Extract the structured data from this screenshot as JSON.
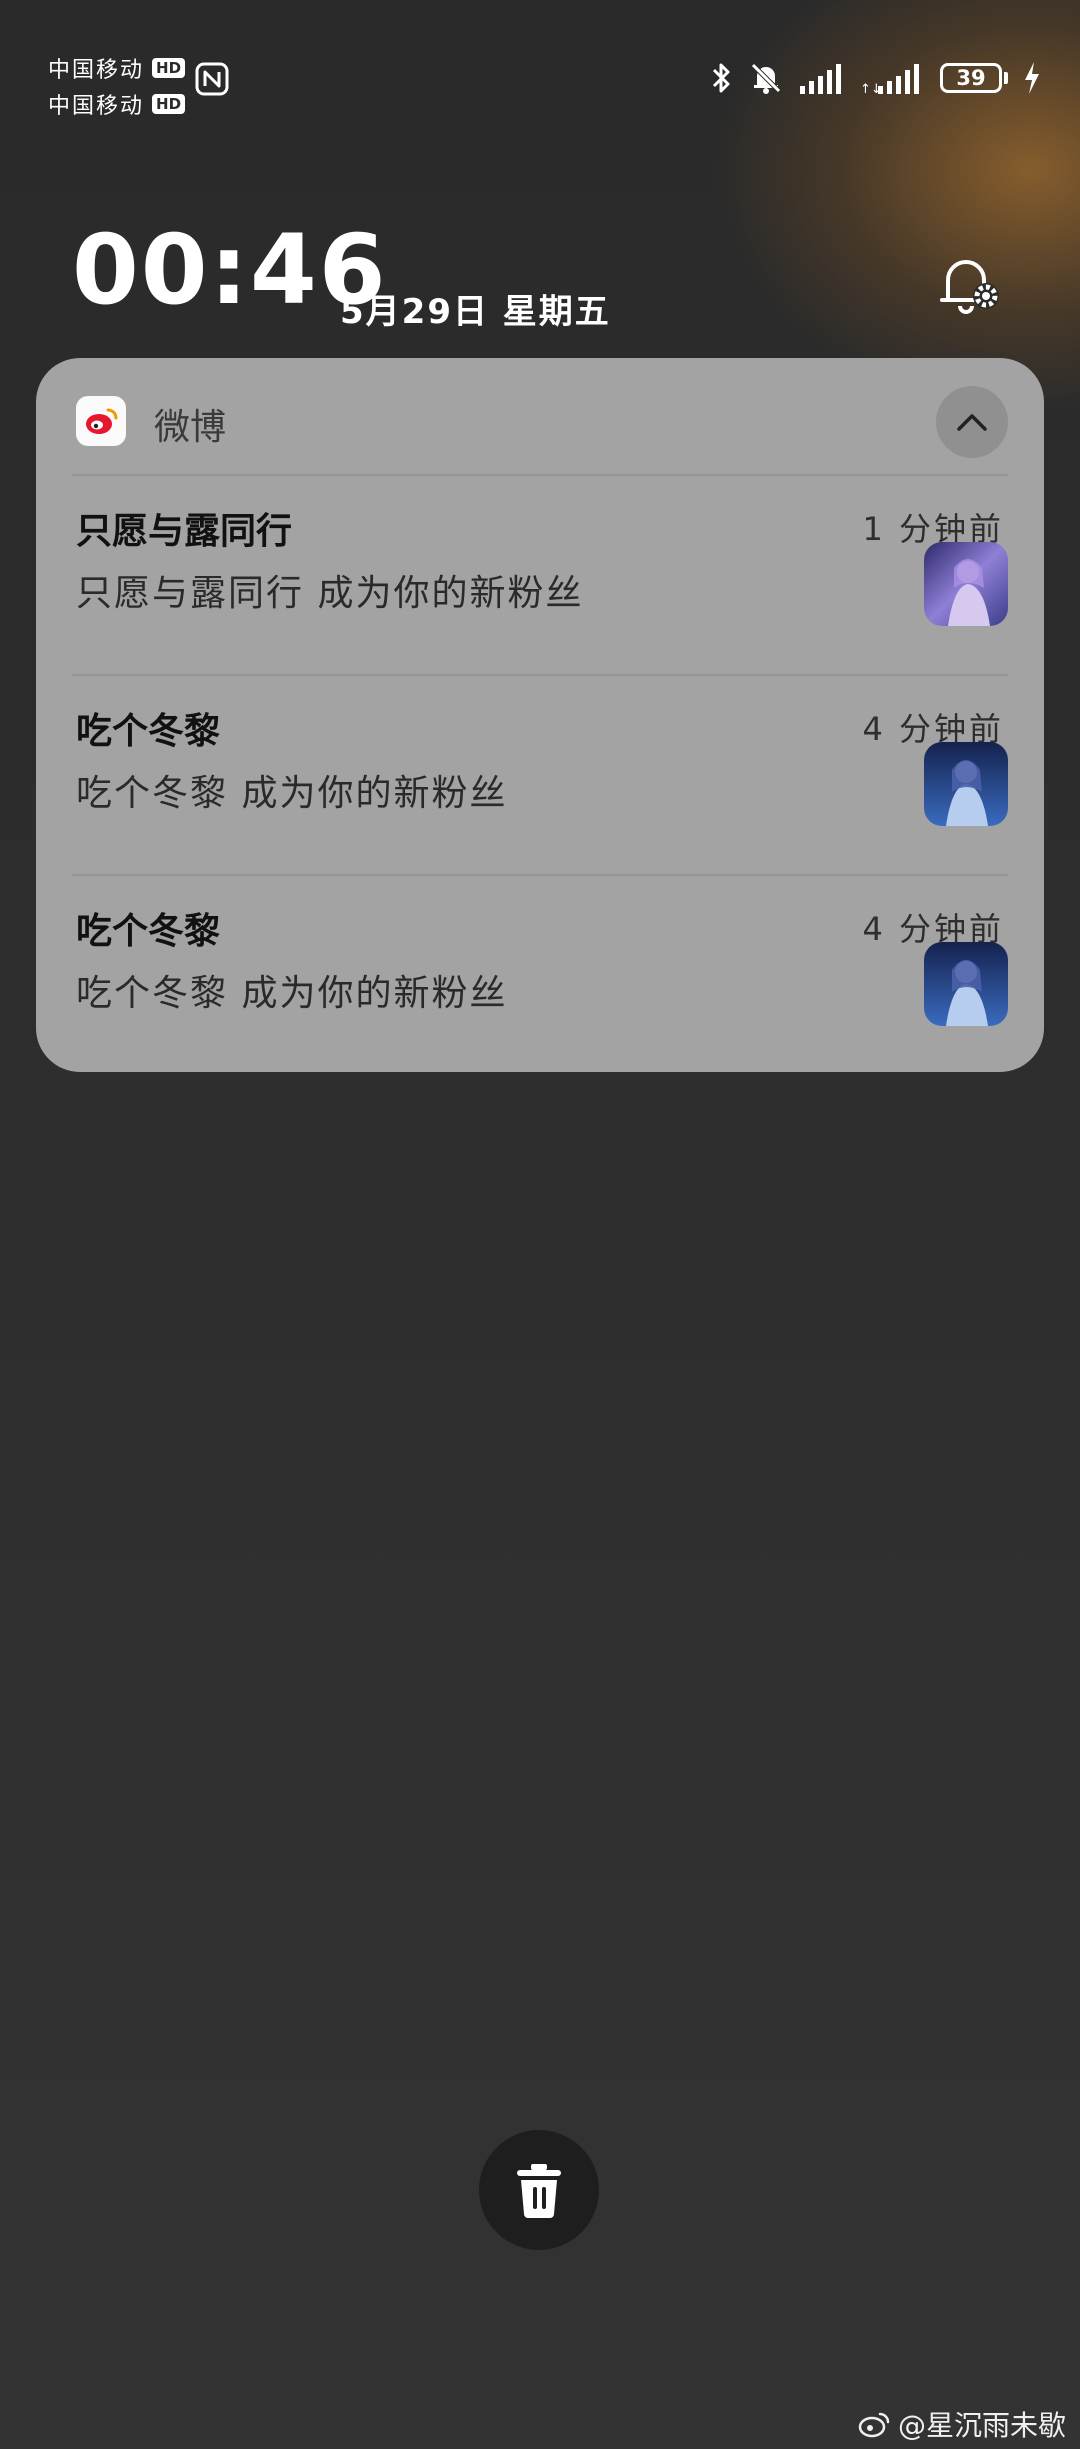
{
  "status_bar": {
    "carriers": [
      {
        "name": "中国移动",
        "badge": "HD"
      },
      {
        "name": "中国移动",
        "badge": "HD"
      }
    ],
    "battery_level": "39",
    "icons": [
      "nfc-icon",
      "bluetooth-icon",
      "bell-muted-icon",
      "signal-icon",
      "signal-icon",
      "battery-icon",
      "charging-icon"
    ]
  },
  "lockscreen": {
    "time": "00:46",
    "date": "5月29日 星期五"
  },
  "notification_group": {
    "app_name": "微博",
    "items": [
      {
        "title": "只愿与露同行",
        "time": "1 分钟前",
        "body": "只愿与露同行 成为你的新粉丝"
      },
      {
        "title": "吃个冬黎",
        "time": "4 分钟前",
        "body": "吃个冬黎 成为你的新粉丝"
      },
      {
        "title": "吃个冬黎",
        "time": "4 分钟前",
        "body": "吃个冬黎 成为你的新粉丝"
      }
    ]
  },
  "watermark": {
    "text": "@星沉雨未歇"
  },
  "colors": {
    "card": "#a3a3a3",
    "background": "#2e2e2e",
    "accent_glow": "#a66e2d",
    "weibo_red": "#e6162d"
  }
}
